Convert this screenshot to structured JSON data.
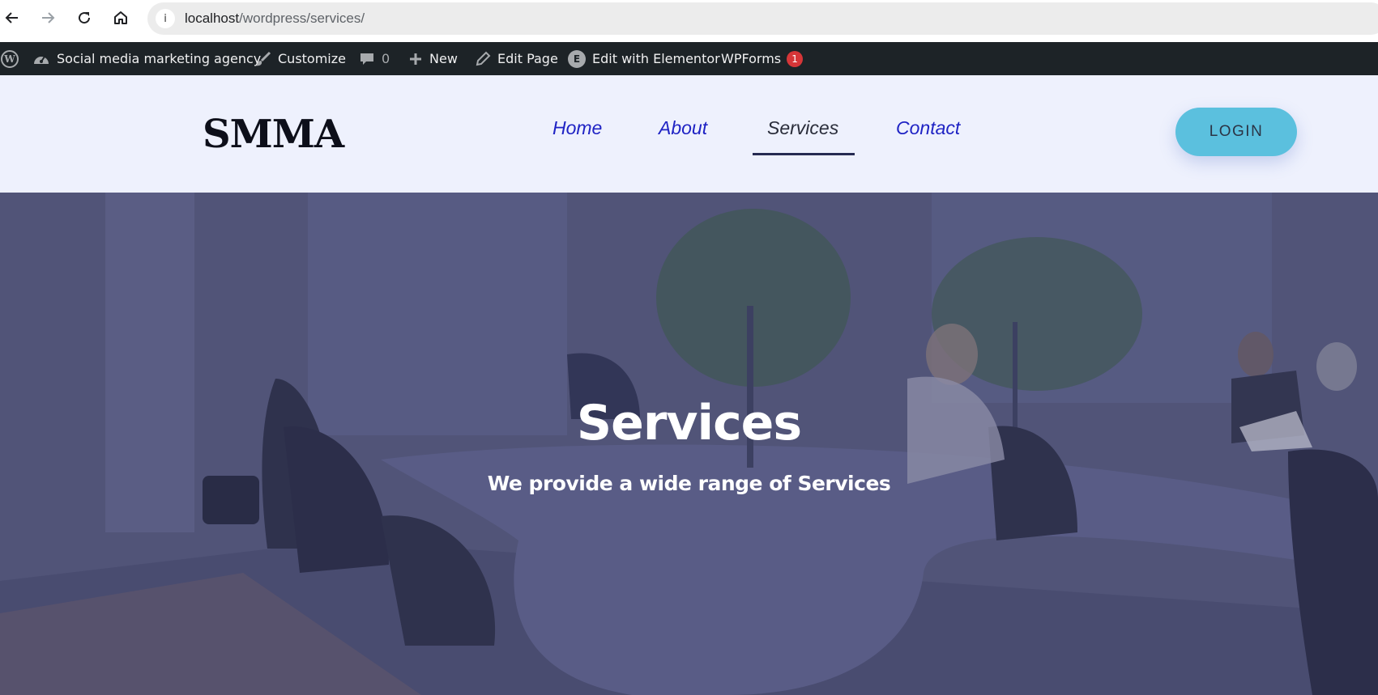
{
  "browser": {
    "url_host": "localhost",
    "url_path": "/wordpress/services/",
    "icons": [
      "back-arrow-icon",
      "forward-arrow-icon",
      "reload-icon",
      "home-icon",
      "site-info-icon"
    ]
  },
  "adminbar": {
    "site_name": "Social media marketing agency",
    "customize": "Customize",
    "comments_count": "0",
    "new": "New",
    "edit_page": "Edit Page",
    "edit_elementor": "Edit with Elementor",
    "wpforms": "WPForms",
    "wpforms_badge": "1"
  },
  "header": {
    "logo": "SMMA",
    "menu": [
      {
        "label": "Home"
      },
      {
        "label": "About"
      },
      {
        "label": "Services",
        "active": true
      },
      {
        "label": "Contact"
      }
    ],
    "login": "LOGIN"
  },
  "hero": {
    "title": "Services",
    "subtitle": "We provide a wide range of Services"
  },
  "colors": {
    "adminbar_bg": "#1d2327",
    "header_bg": "#eef1fd",
    "menu_link": "#1f23c4",
    "login_bg": "#5bc0de",
    "hero_overlay": "#4f5277",
    "badge": "#d63638"
  }
}
